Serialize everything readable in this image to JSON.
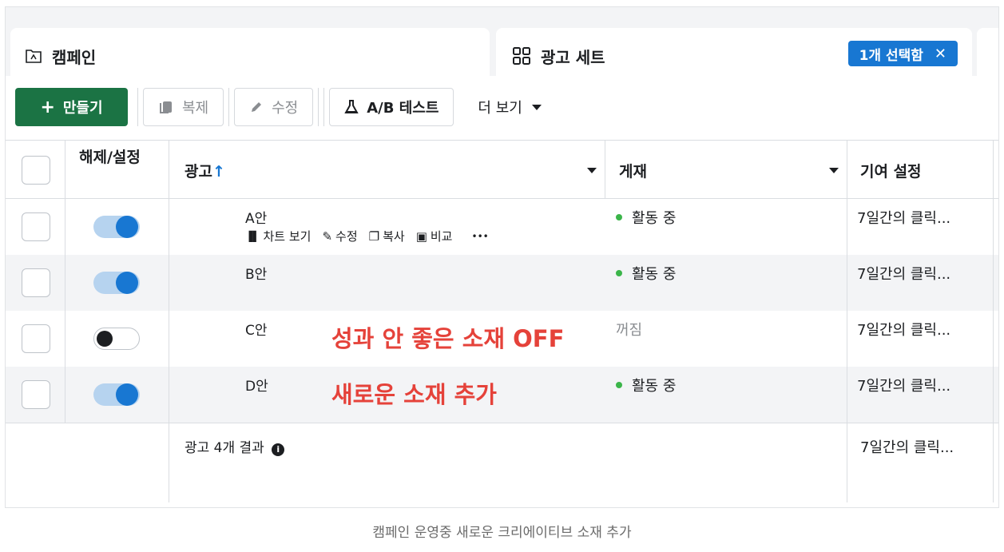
{
  "tabs": {
    "campaign": "캠페인",
    "adset": "광고 세트",
    "selected": "1개 선택함"
  },
  "toolbar": {
    "create": "만들기",
    "duplicate": "복제",
    "edit": "수정",
    "ab_test": "A/B 테스트",
    "more": "더 보기"
  },
  "table": {
    "headers": {
      "toggle": "해제/설정",
      "ad": "광고",
      "delivery": "게재",
      "attribution": "기여 설정"
    },
    "rows": [
      {
        "name": "A안",
        "status": "활동 중",
        "status_active": true,
        "toggle_on": true,
        "attribution": "7일간의 클릭..."
      },
      {
        "name": "B안",
        "status": "활동 중",
        "status_active": true,
        "toggle_on": true,
        "attribution": "7일간의 클릭..."
      },
      {
        "name": "C안",
        "status": "꺼짐",
        "status_active": false,
        "toggle_on": false,
        "attribution": "7일간의 클릭..."
      },
      {
        "name": "D안",
        "status": "활동 중",
        "status_active": true,
        "toggle_on": true,
        "attribution": "7일간의 클릭..."
      }
    ],
    "row_actions": {
      "chart": "차트 보기",
      "edit": "수정",
      "copy": "복사",
      "compare": "비교",
      "more": "•••"
    },
    "footer": {
      "results": "광고 4개 결과",
      "attribution": "7일간의 클릭..."
    }
  },
  "overlays": {
    "off_note": "성과 안 좋은 소재 OFF",
    "add_note": "새로운 소재 추가"
  },
  "caption": "캠페인 운영중 새로운 크리에이티브 소재 추가",
  "colors": {
    "create_button": "#1b7344",
    "selected_pill": "#1877d2",
    "toggle_on": "#1877d2",
    "active_dot": "#3bb54a",
    "annotation": "#e5423a"
  }
}
